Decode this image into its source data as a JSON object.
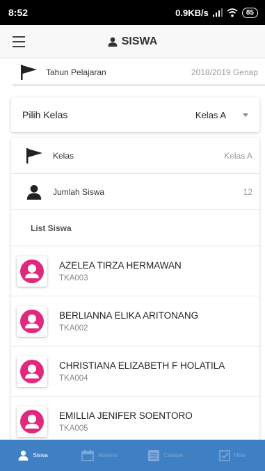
{
  "status": {
    "time": "8:52",
    "speed": "0.9KB/s",
    "battery": "85"
  },
  "appbar": {
    "title": "SISWA"
  },
  "tahun": {
    "label": "Tahun Pelajaran",
    "value": "2018/2019 Genap"
  },
  "pilih_kelas": {
    "label": "Pilih Kelas",
    "value": "Kelas A"
  },
  "kelas": {
    "label": "Kelas",
    "value": "Kelas A"
  },
  "jumlah": {
    "label": "Jumlah Siswa",
    "value": "12"
  },
  "list": {
    "header": "List Siswa",
    "students": [
      {
        "name": "AZELEA TIRZA HERMAWAN",
        "id": "TKA003"
      },
      {
        "name": "BERLIANNA ELIKA ARITONANG",
        "id": "TKA002"
      },
      {
        "name": "CHRISTIANA ELIZABETH F HOLATILA",
        "id": "TKA004"
      },
      {
        "name": "EMILLIA JENIFER SOENTORO",
        "id": "TKA005"
      }
    ]
  },
  "nav": [
    {
      "label": "Siswa",
      "icon": "person-icon",
      "active": true
    },
    {
      "label": "Absensi",
      "icon": "calendar-icon",
      "active": false
    },
    {
      "label": "Catatan",
      "icon": "notes-icon",
      "active": false
    },
    {
      "label": "Nilai",
      "icon": "checkbox-icon",
      "active": false
    }
  ],
  "colors": {
    "nav_bg": "#3f7fc4",
    "avatar_accent": "#e0287d"
  }
}
